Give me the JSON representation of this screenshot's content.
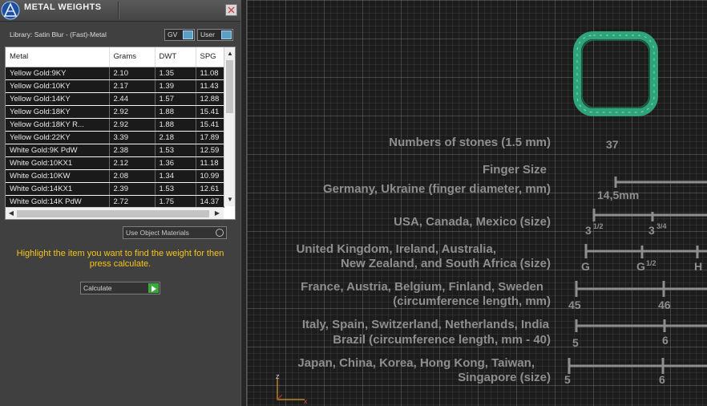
{
  "panel": {
    "title": "METAL WEIGHTS",
    "library_label": "Library: Satin Blur - (Fast)-Metal",
    "gv_toggle": "GV",
    "user_toggle": "User",
    "use_object_materials": "Use Object Materials",
    "hint_text": "Highlight the item you want to find the weight for then press calculate.",
    "calculate_label": "Calculate"
  },
  "table": {
    "columns": [
      "Metal",
      "Grams",
      "DWT",
      "SPG"
    ],
    "rows": [
      [
        "Yellow Gold:9KY",
        "2.10",
        "1.35",
        "11.08"
      ],
      [
        "Yellow Gold:10KY",
        "2.17",
        "1.39",
        "11.43"
      ],
      [
        "Yellow Gold:14KY",
        "2.44",
        "1.57",
        "12.88"
      ],
      [
        "Yellow Gold:18KY",
        "2.92",
        "1.88",
        "15.41"
      ],
      [
        "Yellow Gold:18KY R...",
        "2.92",
        "1.88",
        "15.41"
      ],
      [
        "Yellow Gold:22KY",
        "3.39",
        "2.18",
        "17.89"
      ],
      [
        "White Gold:9K PdW",
        "2.38",
        "1.53",
        "12.59"
      ],
      [
        "White Gold:10KX1",
        "2.12",
        "1.36",
        "11.18"
      ],
      [
        "White Gold:10KW",
        "2.08",
        "1.34",
        "10.99"
      ],
      [
        "White Gold:14KX1",
        "2.39",
        "1.53",
        "12.61"
      ],
      [
        "White Gold:14K PdW",
        "2.72",
        "1.75",
        "14.37"
      ]
    ]
  },
  "viewport": {
    "stones_label": "Numbers of stones (1.5 mm)",
    "stones_value": "37",
    "finger_size_label": "Finger Size",
    "germany_label": "Germany, Ukraine  (finger diameter, mm)",
    "germany_value": "14,5mm",
    "usa_label": "USA, Canada, Mexico (size)",
    "usa_tick1": "3",
    "usa_tick1_frac": "1/2",
    "usa_tick2": "3",
    "usa_tick2_frac": "3/4",
    "uk_label_line1": "United Kingdom, Ireland, Australia,",
    "uk_label_line2": "New Zealand, and South Africa (size)",
    "uk_tick1": "G",
    "uk_tick2": "G",
    "uk_tick2_frac": "1/2",
    "uk_tick3": "H",
    "france_label_line1": "France, Austria, Belgium, Finland, Sweden",
    "france_label_line2": "(circumference length, mm)",
    "france_tick1": "45",
    "france_tick2": "46",
    "italy_label_line1": "Italy, Spain, Switzerland, Netherlands, India",
    "italy_label_line2": "Brazil  (circumference length, mm - 40)",
    "italy_tick1": "5",
    "italy_tick2": "6",
    "japan_label_line1": "Japan, China, Korea, Hong Kong, Taiwan,",
    "japan_label_line2": "Singapore (size)",
    "japan_tick1": "5",
    "japan_tick2": "6",
    "axis_z": "z",
    "axis_x": "x"
  },
  "colors": {
    "hint": "#f5c518",
    "ring_green": "#2fa37a",
    "toggle_blue": "#5d9ec4",
    "calculate_green": "#3ba83b"
  }
}
